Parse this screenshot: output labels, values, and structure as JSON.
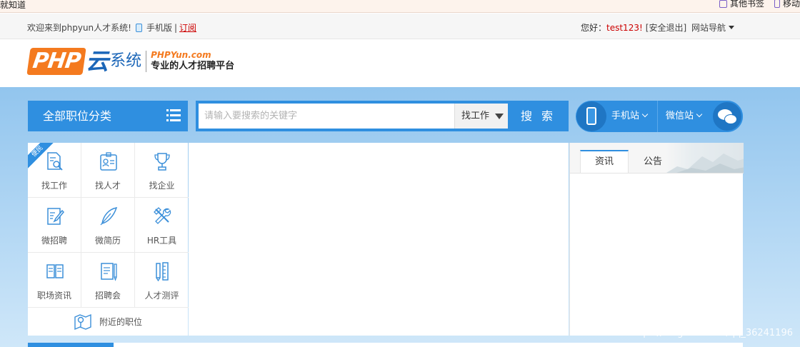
{
  "browser_bookmarks": {
    "left_text": "就知道",
    "items": [
      {
        "label": "其他书签",
        "icon": "folder-icon"
      },
      {
        "label": "移动",
        "icon": "phone-bookmark-icon"
      }
    ]
  },
  "topbar": {
    "welcome": "欢迎来到phpyun人才系统!",
    "mobile_label": "手机版",
    "separator": "|",
    "subscribe": "订阅",
    "greeting": "您好：",
    "username": "test123",
    "exclaim": "!",
    "logout": "[安全退出]",
    "site_nav": "网站导航"
  },
  "logo": {
    "php": "PHP",
    "yun": "云",
    "system": "系统",
    "domain": "PHPYun.com",
    "slogan": "专业的人才招聘平台"
  },
  "category": {
    "label": "全部职位分类"
  },
  "search": {
    "placeholder": "请输入要搜索的关键字",
    "type": "找工作",
    "button": "搜 索"
  },
  "mobile_bar": {
    "mobile_site": "手机站",
    "wechat_site": "微信站"
  },
  "quick_grid": {
    "ribbon": "便民",
    "items": [
      {
        "label": "找工作",
        "icon": "search-doc-icon"
      },
      {
        "label": "找人才",
        "icon": "id-badge-icon"
      },
      {
        "label": "找企业",
        "icon": "trophy-icon"
      },
      {
        "label": "微招聘",
        "icon": "edit-doc-icon"
      },
      {
        "label": "微简历",
        "icon": "feather-icon"
      },
      {
        "label": "HR工具",
        "icon": "tools-icon"
      },
      {
        "label": "职场资讯",
        "icon": "book-icon"
      },
      {
        "label": "招聘会",
        "icon": "notepad-icon"
      },
      {
        "label": "人才测评",
        "icon": "ruler-pencil-icon"
      }
    ],
    "nearby": "附近的职位"
  },
  "news": {
    "tabs": [
      {
        "label": "资讯",
        "active": true
      },
      {
        "label": "公告",
        "active": false
      }
    ]
  },
  "watermark": "https://blog.csdn.net/qq_36241196",
  "colors": {
    "primary_blue": "#2f8fe0",
    "logo_orange": "#f47a1f",
    "logo_blue": "#1b66b8",
    "alert_red": "#cc0000"
  }
}
